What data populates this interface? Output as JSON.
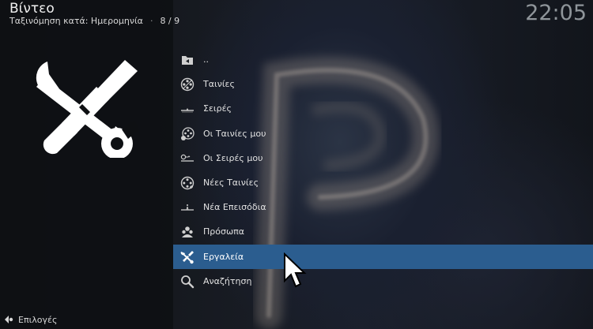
{
  "header": {
    "title": "Βίντεο",
    "sort_label": "Ταξινόμηση κατά: Ημερομηνία",
    "separator": "·",
    "page_counter": "8 / 9",
    "clock": "22:05"
  },
  "artwork": {
    "icon": "tools-icon"
  },
  "menu": {
    "items": [
      {
        "label": "..",
        "icon": "folder-back-icon"
      },
      {
        "label": "Ταινίες",
        "icon": "film-reel-icon"
      },
      {
        "label": "Σειρές",
        "icon": "tv-series-icon"
      },
      {
        "label": "Οι Ταινίες μου",
        "icon": "my-movies-icon"
      },
      {
        "label": "Οι Σειρές μου",
        "icon": "my-tvshows-icon"
      },
      {
        "label": "Νέες Ταινίες",
        "icon": "new-movies-icon"
      },
      {
        "label": "Νέα Επεισόδια",
        "icon": "new-episodes-icon"
      },
      {
        "label": "Πρόσωπα",
        "icon": "people-icon"
      },
      {
        "label": "Εργαλεία",
        "icon": "tools-icon",
        "selected": true
      },
      {
        "label": "Αναζήτηση",
        "icon": "search-icon"
      }
    ]
  },
  "footer": {
    "label": "Επιλογές",
    "icon": "options-icon"
  },
  "colors": {
    "highlight": "#2b5d8f",
    "background": "#0f1215",
    "panel": "#0e1013"
  }
}
